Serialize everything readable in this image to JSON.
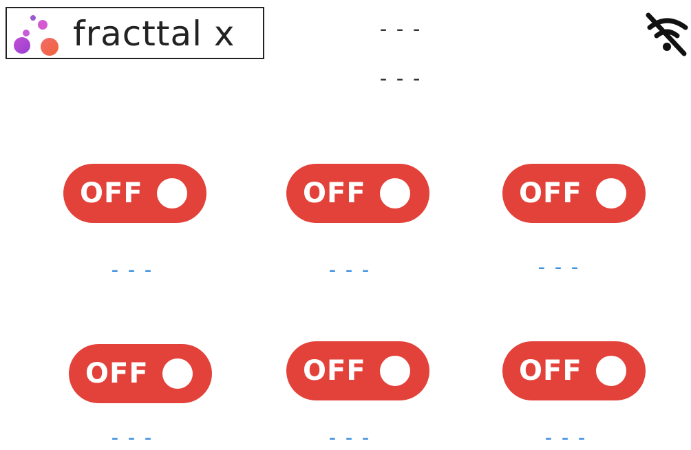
{
  "header": {
    "logo_text": "fracttal x",
    "status_line_1": "---",
    "status_line_2": "---",
    "connection_icon": "wifi-off-icon"
  },
  "switches": [
    {
      "state": "OFF",
      "value": "---"
    },
    {
      "state": "OFF",
      "value": "---"
    },
    {
      "state": "OFF",
      "value": "---"
    },
    {
      "state": "OFF",
      "value": "---"
    },
    {
      "state": "OFF",
      "value": "---"
    },
    {
      "state": "OFF",
      "value": "---"
    }
  ],
  "colors": {
    "toggle_off": "#e3423a",
    "value_text": "#3e8fe0",
    "logo_purple": "#b04fd0",
    "logo_orange": "#f06a3c"
  }
}
